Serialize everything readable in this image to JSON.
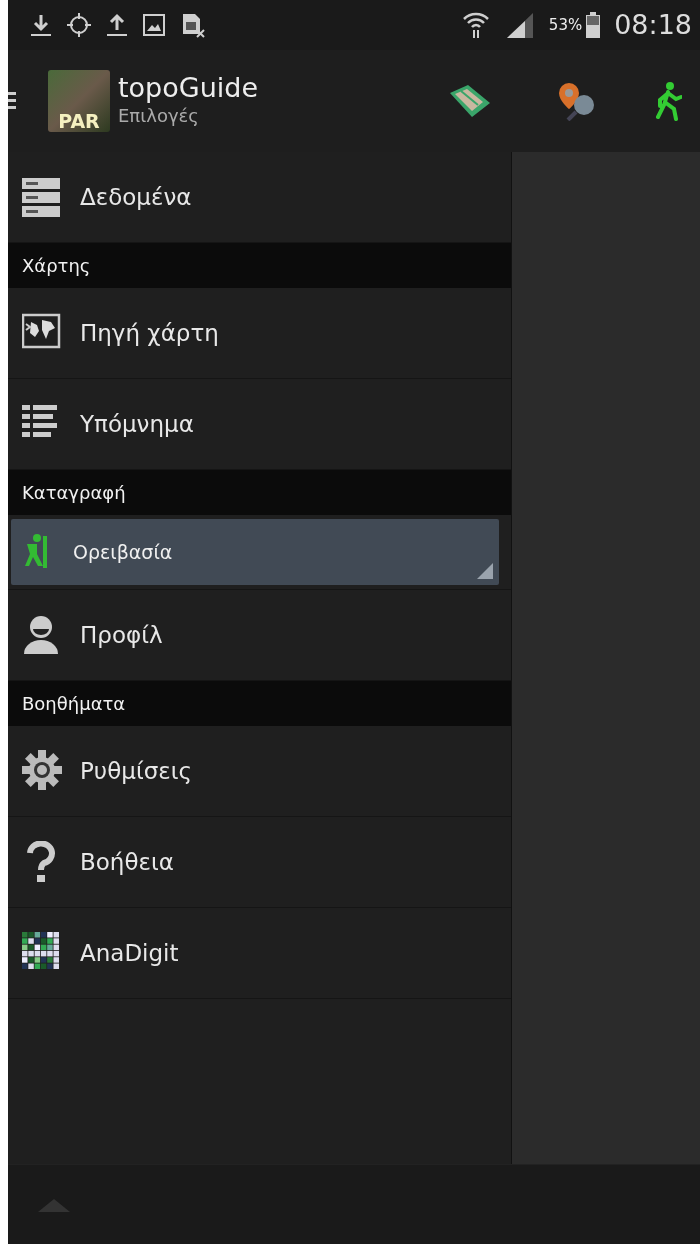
{
  "status_bar": {
    "battery": "53%",
    "time": "08:18"
  },
  "app_bar": {
    "title": "topoGuide",
    "subtitle": "Επιλογές",
    "logo_text": "PAR"
  },
  "drawer": [
    {
      "kind": "item",
      "label": "Δεδομένα"
    },
    {
      "kind": "section",
      "label": "Χάρτης"
    },
    {
      "kind": "item",
      "label": "Πηγή χάρτη"
    },
    {
      "kind": "item",
      "label": "Υπόμνημα"
    },
    {
      "kind": "section",
      "label": "Καταγραφή"
    },
    {
      "kind": "spinner",
      "label": "Ορειβασία"
    },
    {
      "kind": "item",
      "label": "Προφίλ"
    },
    {
      "kind": "section",
      "label": "Βοηθήματα"
    },
    {
      "kind": "item",
      "label": "Ρυθμίσεις"
    },
    {
      "kind": "item",
      "label": "Βοήθεια"
    },
    {
      "kind": "item",
      "label": "AnaDigit"
    }
  ]
}
